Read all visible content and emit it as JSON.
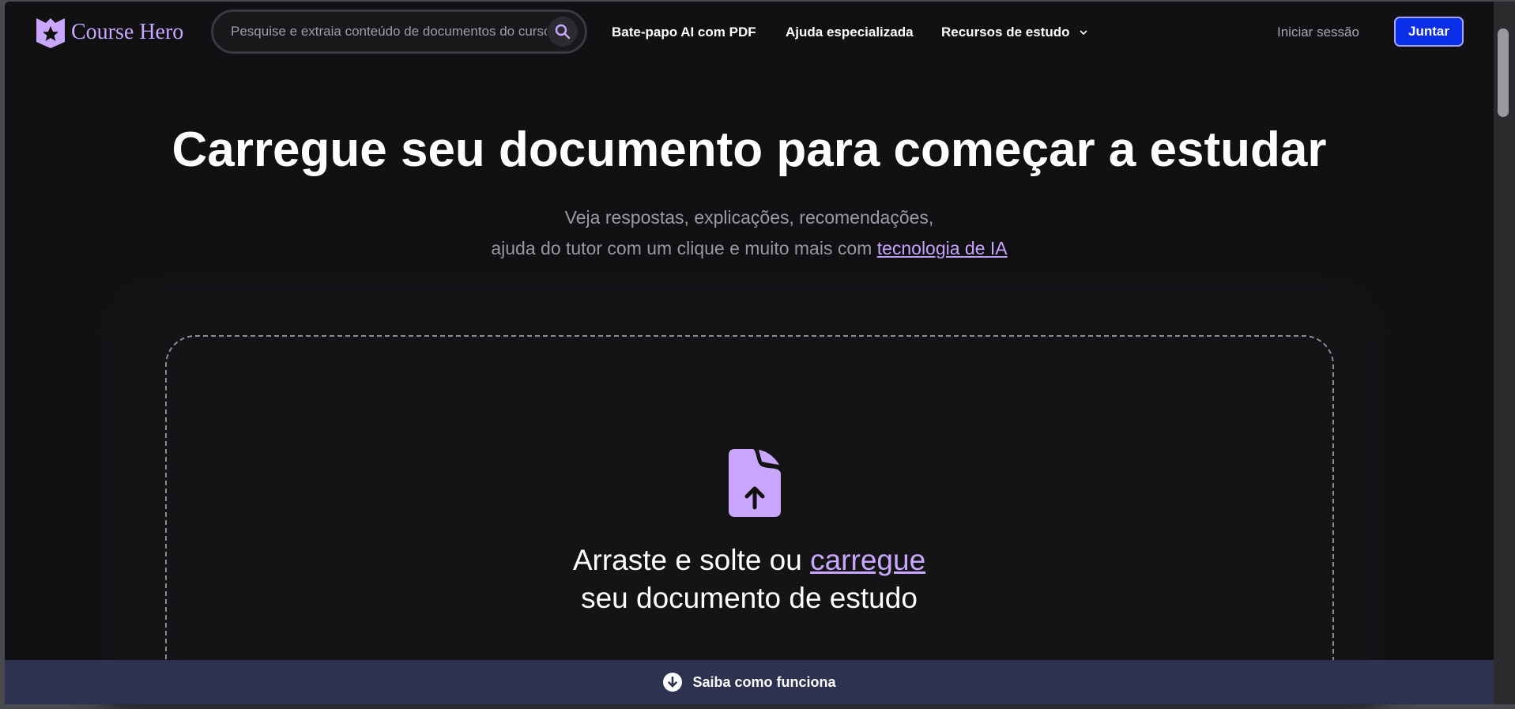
{
  "header": {
    "logo": "Course Hero",
    "search_placeholder": "Pesquise e extraia conteúdo de documentos do curso",
    "nav": [
      "Bate-papo AI com PDF",
      "Ajuda especializada",
      "Recursos de estudo"
    ],
    "login": "Iniciar sessão",
    "join": "Juntar"
  },
  "hero": {
    "title": "Carregue seu documento para começar a estudar",
    "sub_line1": "Veja respostas, explicações, recomendações,",
    "sub_line2": "ajuda do tutor com um clique e muito mais com",
    "sub_link": "tecnologia de IA"
  },
  "upload": {
    "text1": "Arraste e solte ou",
    "link": "carregue",
    "text2": "seu documento de estudo"
  },
  "footer": {
    "label": "Saiba como funciona"
  },
  "colors": {
    "accent": "#c9a6ff",
    "button": "#0b2ee8",
    "bar": "#2d3250"
  }
}
